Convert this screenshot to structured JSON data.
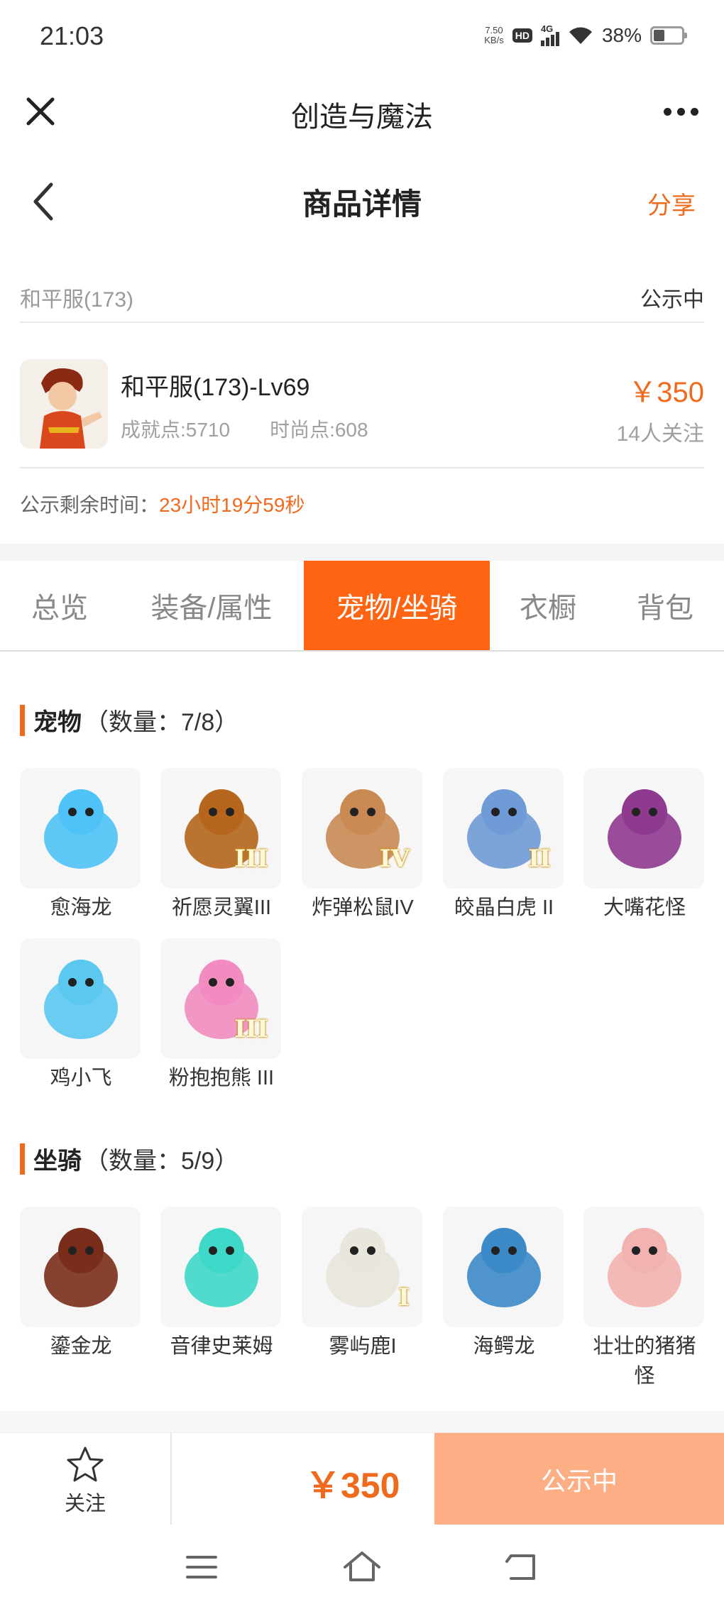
{
  "status_bar": {
    "time": "21:03",
    "net_speed_value": "7.50",
    "net_speed_unit": "KB/s",
    "hd": "HD",
    "network": "4G",
    "battery": "38%"
  },
  "app_bar": {
    "title": "创造与魔法"
  },
  "page_header": {
    "title": "商品详情",
    "share": "分享"
  },
  "product": {
    "server": "和平服(173)",
    "status": "公示中",
    "name": "和平服(173)-Lv69",
    "achievement": "成就点:5710",
    "fashion": "时尚点:608",
    "price": "￥350",
    "followers": "14人关注",
    "countdown_label": "公示剩余时间：",
    "countdown_value": "23小时19分59秒"
  },
  "tabs": [
    {
      "label": "总览",
      "active": false
    },
    {
      "label": "装备/属性",
      "active": false
    },
    {
      "label": "宠物/坐骑",
      "active": true
    },
    {
      "label": "衣橱",
      "active": false
    },
    {
      "label": "背包",
      "active": false
    }
  ],
  "pets": {
    "title": "宠物",
    "count": "（数量：7/8）",
    "items": [
      {
        "name": "愈海龙",
        "rank": "",
        "icon": "blue-dragon-icon",
        "color": "#4fc3f7"
      },
      {
        "name": "祈愿灵翼III",
        "rank": "III",
        "icon": "eagle-icon",
        "color": "#b5651d"
      },
      {
        "name": "炸弹松鼠IV",
        "rank": "IV",
        "icon": "squirrel-icon",
        "color": "#c98a54"
      },
      {
        "name": "皎晶白虎 II",
        "rank": "II",
        "icon": "white-tiger-icon",
        "color": "#6f9bd6"
      },
      {
        "name": "大嘴花怪",
        "rank": "",
        "icon": "flower-monster-icon",
        "color": "#8e3a8f"
      },
      {
        "name": "鸡小飞",
        "rank": "",
        "icon": "blue-chick-icon",
        "color": "#5bc8ef"
      },
      {
        "name": "粉抱抱熊 III",
        "rank": "III",
        "icon": "pink-bear-icon",
        "color": "#f28cc0"
      }
    ]
  },
  "mounts": {
    "title": "坐骑",
    "count": "（数量：5/9）",
    "items": [
      {
        "name": "鎏金龙",
        "rank": "",
        "icon": "golden-dragon-icon",
        "color": "#7a2d1a"
      },
      {
        "name": "音律史莱姆",
        "rank": "",
        "icon": "slime-icon",
        "color": "#3ed8c8"
      },
      {
        "name": "雾屿鹿I",
        "rank": "I",
        "icon": "deer-icon",
        "color": "#e9e6dd"
      },
      {
        "name": "海鳄龙",
        "rank": "",
        "icon": "sea-dragon-icon",
        "color": "#3d8ac8"
      },
      {
        "name": "壮壮的猪猪怪",
        "rank": "",
        "icon": "pig-icon",
        "color": "#f2b3b0"
      }
    ]
  },
  "action_bar": {
    "follow_label": "关注",
    "price": "￥350",
    "button_label": "公示中"
  },
  "colors": {
    "accent": "#f06a1d",
    "tab_active": "#fe6411",
    "button_disabled": "#fdae84"
  }
}
